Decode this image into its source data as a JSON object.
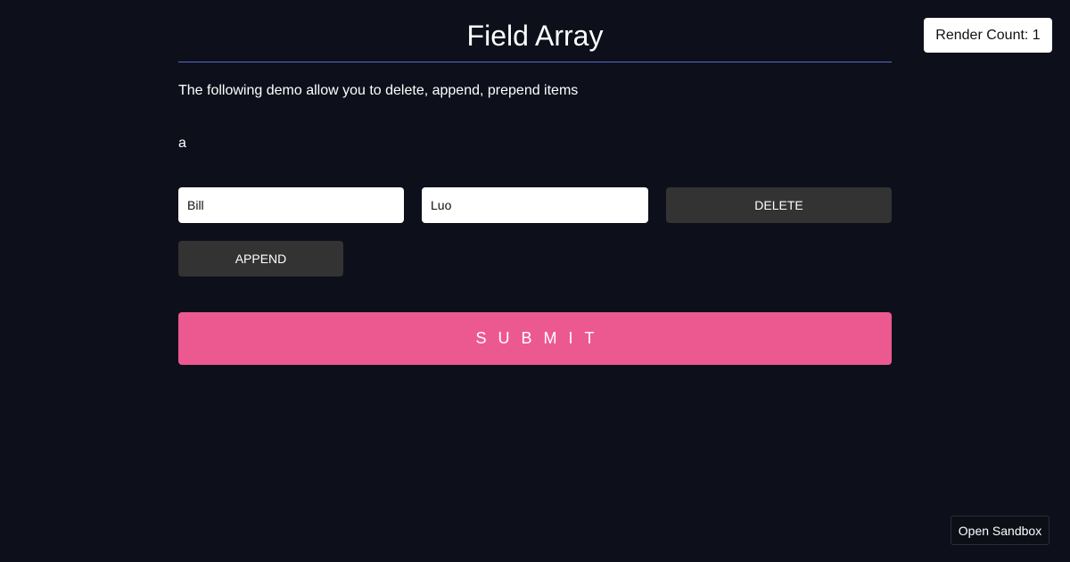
{
  "header": {
    "title": "Field Array"
  },
  "description": "The following demo allow you to delete, append, prepend items",
  "field_array": {
    "label": "a",
    "items": [
      {
        "first_name": "Bill",
        "last_name": "Luo",
        "delete_label": "DELETE"
      }
    ],
    "append_label": "APPEND"
  },
  "submit_label": "SUBMIT",
  "render_count": {
    "label": "Render Count: 1"
  },
  "sandbox": {
    "label": "Open Sandbox"
  },
  "colors": {
    "background": "#0d101b",
    "accent_line": "#5a6ad0",
    "submit": "#ec5990",
    "dark_button": "#333333"
  }
}
